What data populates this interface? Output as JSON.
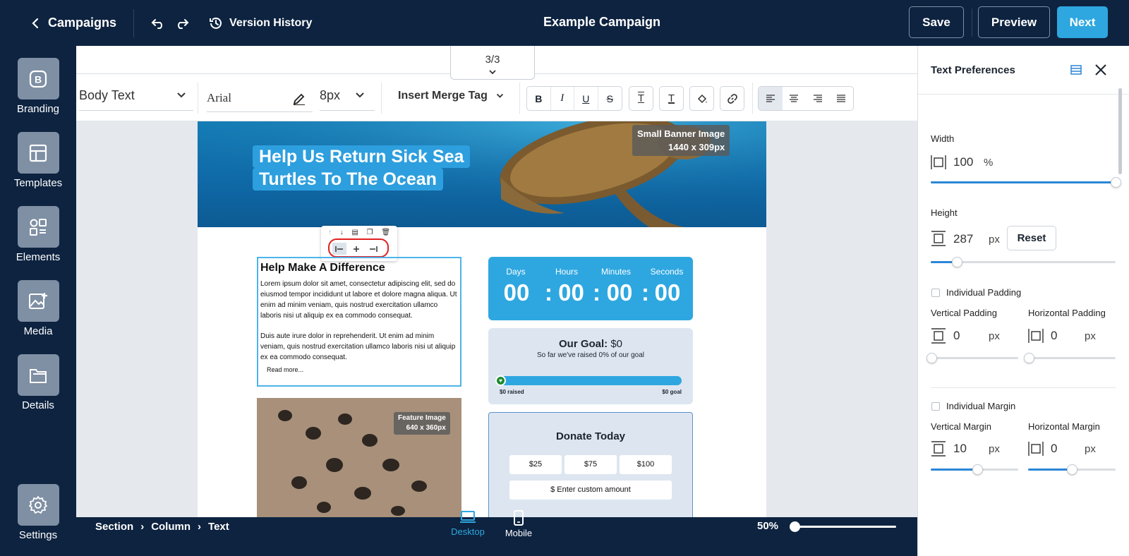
{
  "topbar": {
    "back_label": "Campaigns",
    "version_history": "Version History",
    "title": "Example Campaign",
    "save": "Save",
    "preview": "Preview",
    "next": "Next"
  },
  "sidebar": {
    "items": [
      {
        "label": "Branding",
        "icon": "branding-icon"
      },
      {
        "label": "Templates",
        "icon": "templates-icon"
      },
      {
        "label": "Elements",
        "icon": "elements-icon"
      },
      {
        "label": "Media",
        "icon": "media-icon"
      },
      {
        "label": "Details",
        "icon": "details-icon"
      },
      {
        "label": "Settings",
        "icon": "gear-icon"
      }
    ]
  },
  "toolbar": {
    "page_indicator": "3/3",
    "text_style": "Body Text",
    "font": "Arial",
    "font_size": "8px",
    "merge_tag": "Insert Merge Tag"
  },
  "email": {
    "banner_headline_1": "Help Us Return Sick Sea",
    "banner_headline_2": "Turtles To The Ocean",
    "banner_tag_1": "Small Banner Image",
    "banner_tag_2": "1440 x 309px",
    "text_heading": "Help Make A Difference",
    "text_p1": "Lorem ipsum dolor sit amet, consectetur adipiscing elit, sed do eiusmod tempor incididunt ut labore et dolore magna aliqua. Ut enim ad minim veniam, quis nostrud exercitation ullamco laboris nisi ut aliquip ex ea commodo consequat.",
    "text_p2": "Duis aute irure dolor in reprehenderit. Ut enim ad minim veniam, quis nostrud exercitation ullamco laboris nisi ut aliquip ex ea commodo consequat.",
    "read_more": "Read more...",
    "timer": {
      "labels": [
        "Days",
        "Hours",
        "Minutes",
        "Seconds"
      ],
      "values": [
        "00",
        "00",
        "00",
        "00"
      ],
      "sep": ":"
    },
    "goal": {
      "title_bold": "Our Goal:",
      "title_amount": "$0",
      "subtitle": "So far we've raised 0% of our goal",
      "progress": 0,
      "raised": "$0 raised",
      "goal_label": "$0 goal"
    },
    "donate": {
      "title": "Donate Today",
      "amounts": [
        "$25",
        "$75",
        "$100"
      ],
      "custom": "$ Enter custom amount"
    },
    "feature_tag_1": "Feature Image",
    "feature_tag_2": "640 x 360px"
  },
  "statusbar": {
    "crumbs": [
      "Section",
      "Column",
      "Text"
    ],
    "sep": "›",
    "desktop": "Desktop",
    "mobile": "Mobile",
    "zoom": "50%",
    "zoom_level": 0
  },
  "panel": {
    "title": "Text Preferences",
    "width_label": "Width",
    "width_value": "100",
    "width_unit": "%",
    "width_level": 1.0,
    "height_label": "Height",
    "height_value": "287",
    "height_unit": "px",
    "reset": "Reset",
    "height_level": 0.14,
    "individual_padding": "Individual Padding",
    "vpad_label": "Vertical Padding",
    "vpad_value": "0",
    "hpad_label": "Horizontal Padding",
    "hpad_value": "0",
    "individual_margin": "Individual Margin",
    "vmargin_label": "Vertical Margin",
    "vmargin_value": "10",
    "hmargin_label": "Horizontal Margin",
    "hmargin_value": "0",
    "unit_px": "px",
    "vmargin_level": 0.53,
    "hmargin_level": 0.5
  },
  "colors": {
    "navy": "#0d2340",
    "accent": "#2ea7e0",
    "slider_fill": "#2b86d6",
    "highlight": "#e02020"
  }
}
